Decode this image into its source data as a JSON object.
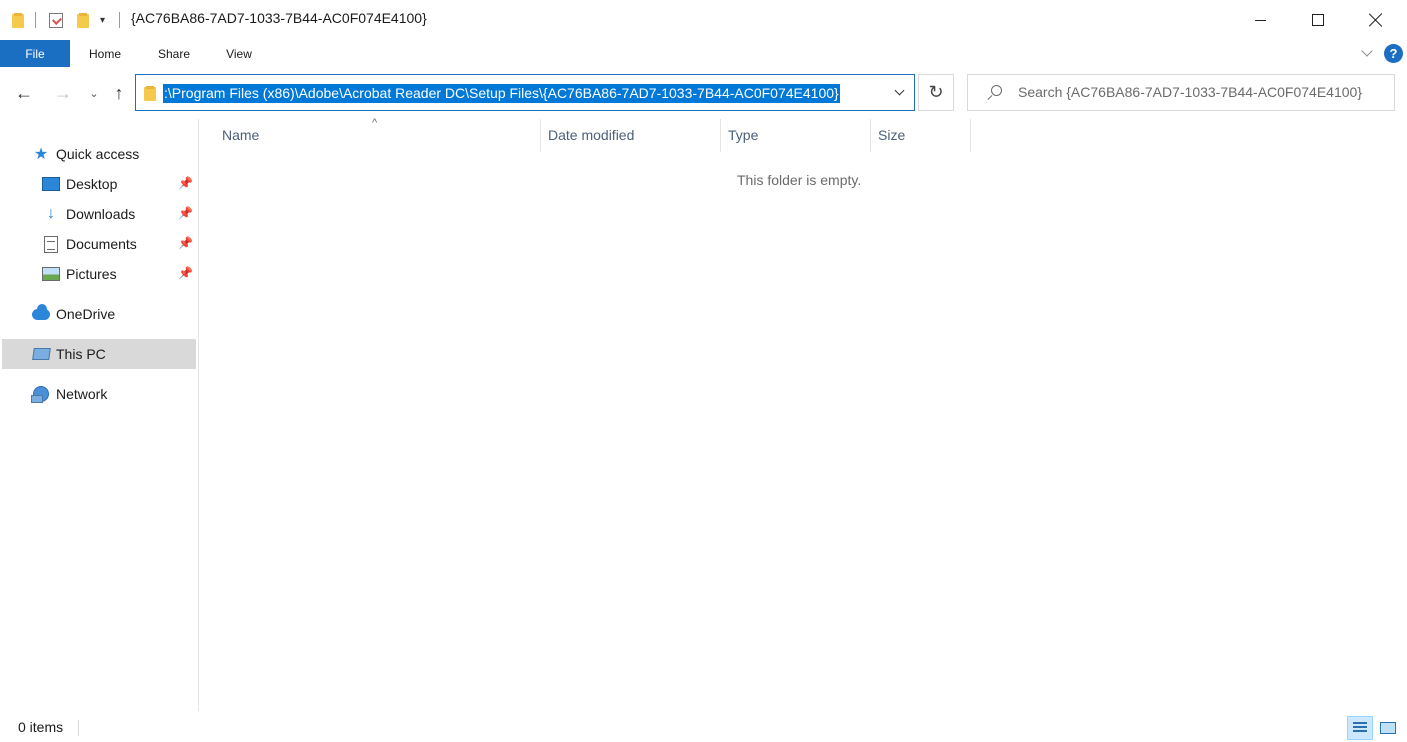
{
  "window": {
    "title": "{AC76BA86-7AD7-1033-7B44-AC0F074E4100}"
  },
  "ribbon": {
    "tabs": [
      "File",
      "Home",
      "Share",
      "View"
    ],
    "help_label": "?"
  },
  "nav": {
    "address_path": ":\\Program Files (x86)\\Adobe\\Acrobat Reader DC\\Setup Files\\{AC76BA86-7AD7-1033-7B44-AC0F074E4100}",
    "search_placeholder": "Search {AC76BA86-7AD7-1033-7B44-AC0F074E4100}"
  },
  "sidebar": {
    "items": [
      {
        "label": "Quick access",
        "icon": "star-icon"
      },
      {
        "label": "Desktop",
        "icon": "desktop-icon",
        "pinned": true
      },
      {
        "label": "Downloads",
        "icon": "download-icon",
        "pinned": true
      },
      {
        "label": "Documents",
        "icon": "documents-icon",
        "pinned": true
      },
      {
        "label": "Pictures",
        "icon": "pictures-icon",
        "pinned": true
      },
      {
        "label": "OneDrive",
        "icon": "cloud-icon"
      },
      {
        "label": "This PC",
        "icon": "computer-icon",
        "selected": true
      },
      {
        "label": "Network",
        "icon": "network-icon"
      }
    ]
  },
  "content": {
    "columns": [
      "Name",
      "Date modified",
      "Type",
      "Size"
    ],
    "empty_message": "This folder is empty."
  },
  "status": {
    "item_count": "0 items"
  },
  "colors": {
    "accent": "#1a6fc3",
    "selection": "#0078d7",
    "sidebar_selected": "#d9d9d9"
  }
}
